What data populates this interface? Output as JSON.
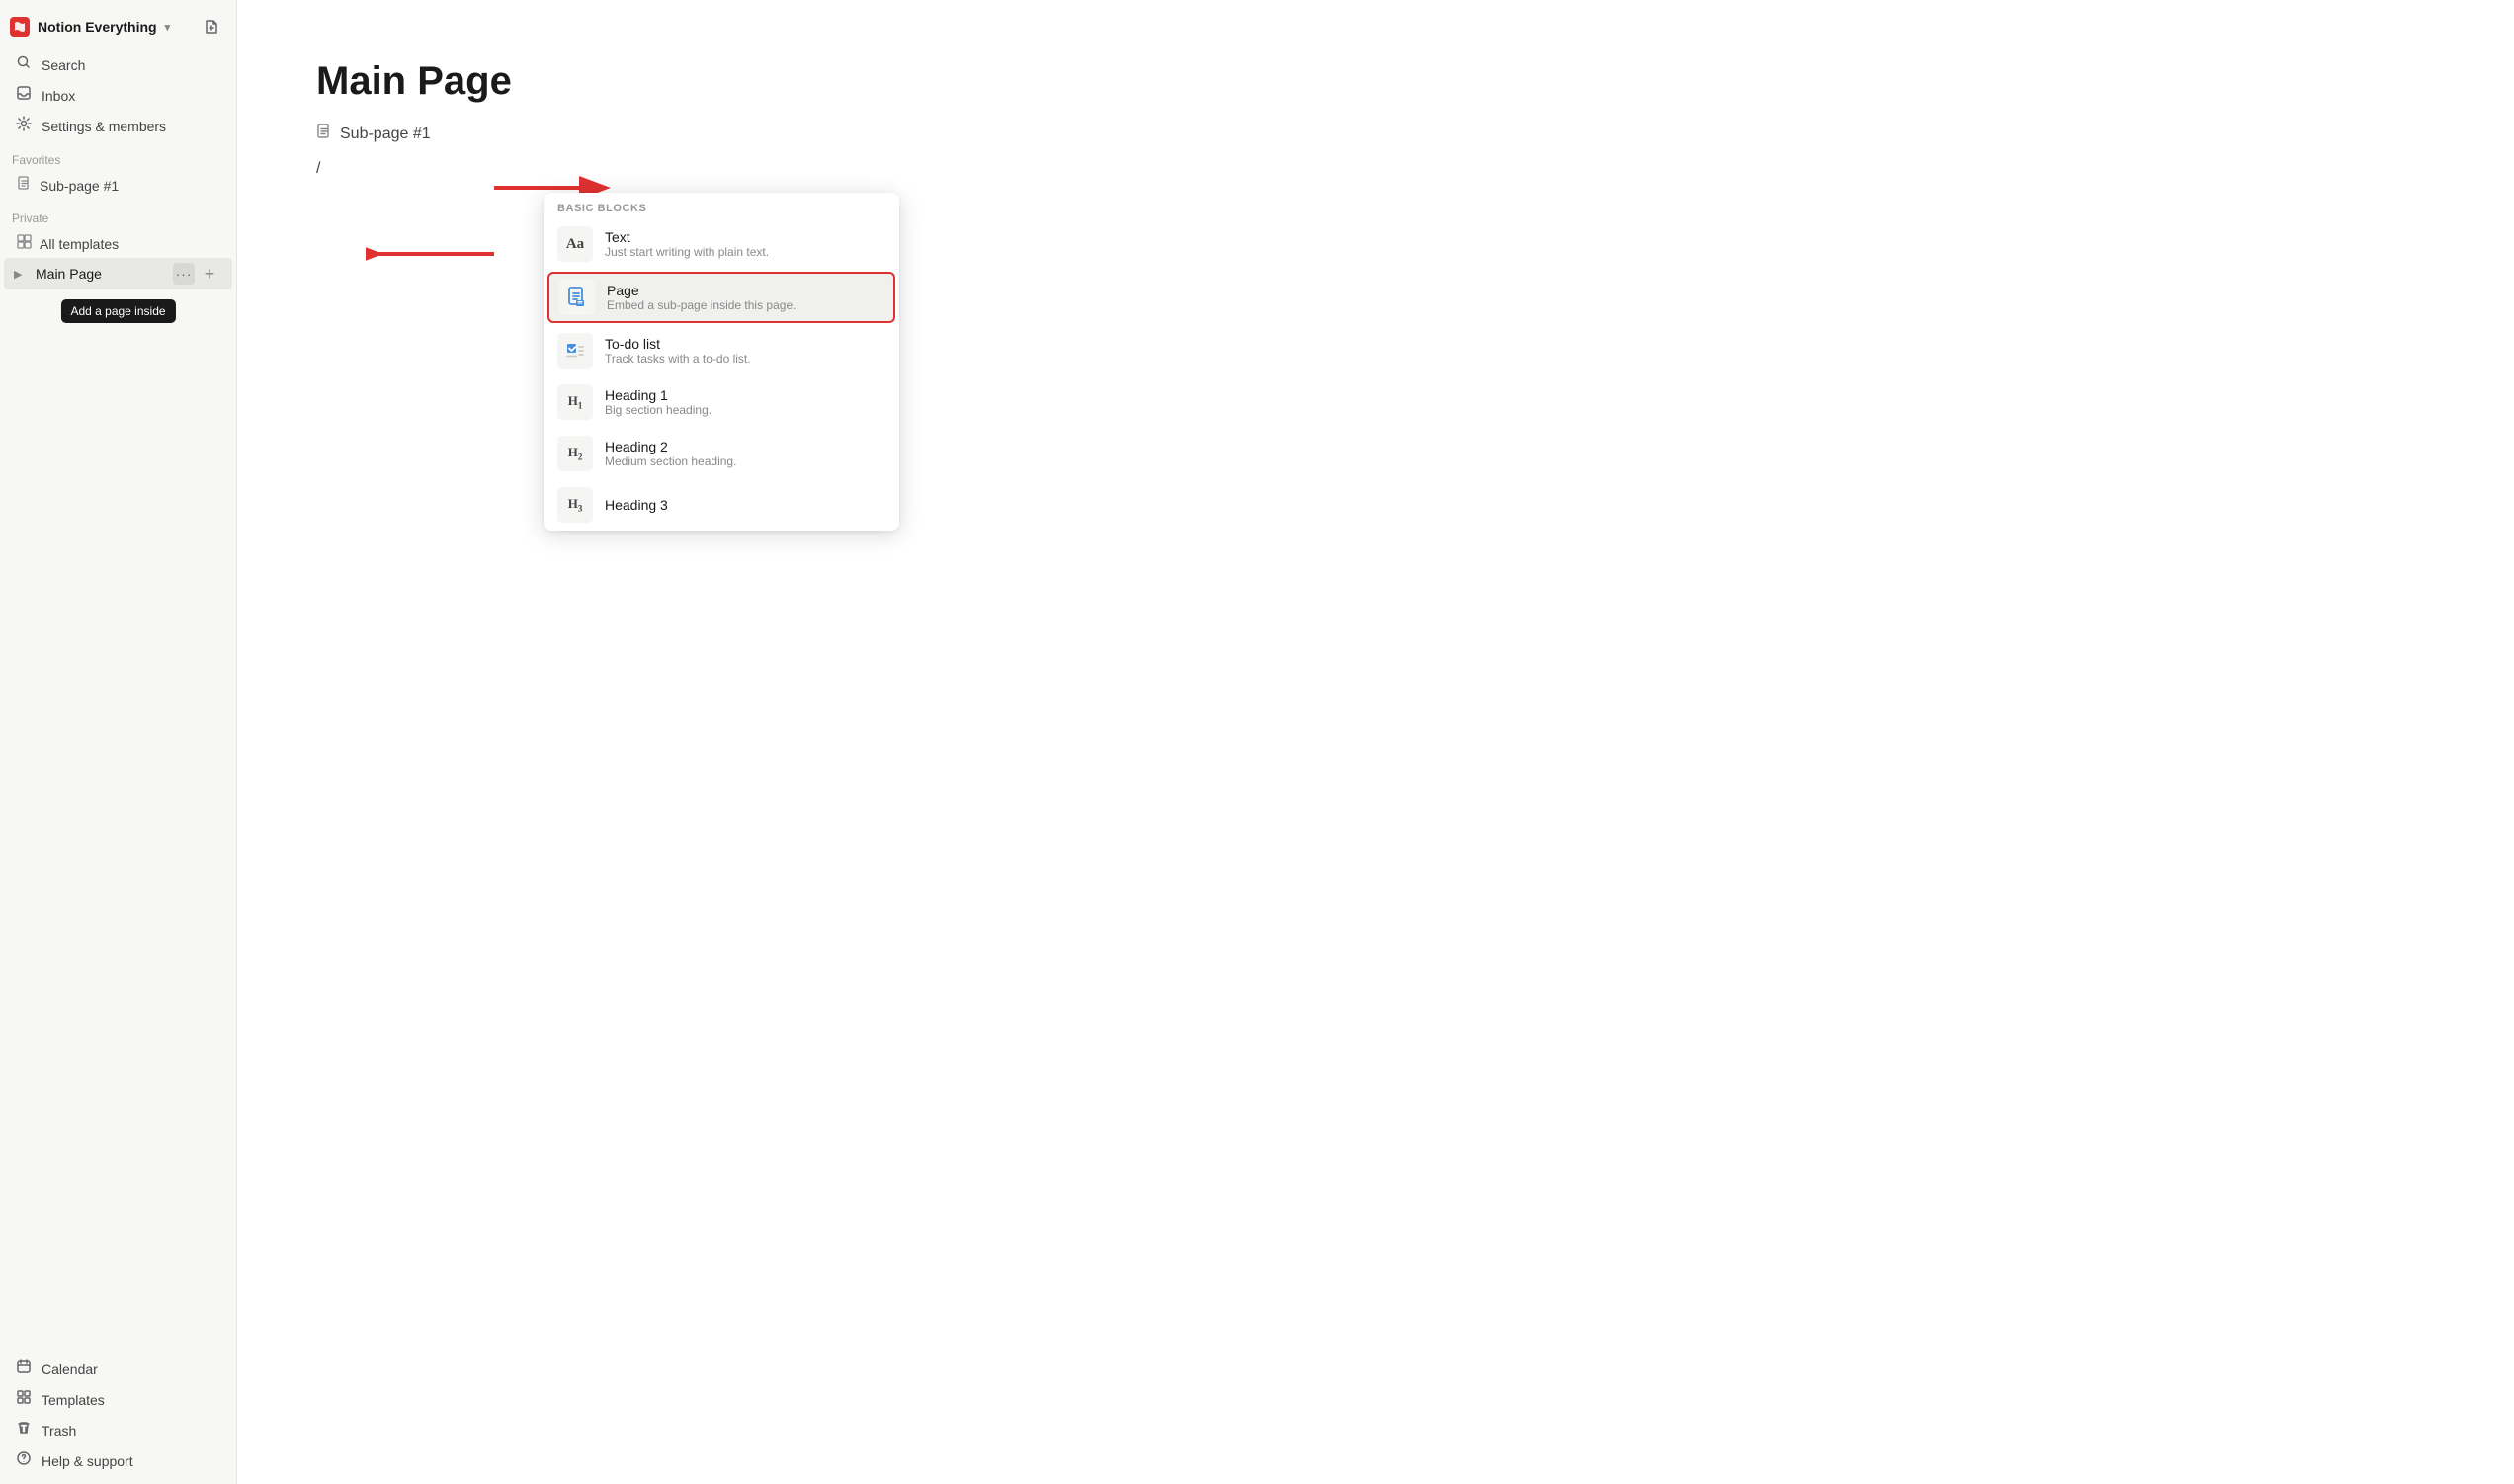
{
  "sidebar": {
    "workspace": {
      "name": "Notion Everything",
      "chevron": "▾"
    },
    "nav": [
      {
        "id": "search",
        "label": "Search",
        "icon": "🔍"
      },
      {
        "id": "inbox",
        "label": "Inbox",
        "icon": "📥"
      },
      {
        "id": "settings",
        "label": "Settings & members",
        "icon": "⚙️"
      }
    ],
    "sections": {
      "favorites": {
        "label": "Favorites",
        "items": [
          {
            "id": "subpage1",
            "label": "Sub-page #1"
          }
        ]
      },
      "private": {
        "label": "Private",
        "items": [
          {
            "id": "all-templates",
            "label": "All templates"
          },
          {
            "id": "main-page",
            "label": "Main Page"
          }
        ]
      }
    },
    "bottom": [
      {
        "id": "calendar",
        "label": "Calendar",
        "icon": "📅"
      },
      {
        "id": "templates",
        "label": "Templates",
        "icon": "📋"
      },
      {
        "id": "trash",
        "label": "Trash",
        "icon": "🗑️"
      },
      {
        "id": "help",
        "label": "Help & support",
        "icon": "❓"
      }
    ],
    "tooltip": "Add a page inside"
  },
  "main": {
    "page_title": "Main Page",
    "sub_page_label": "Sub-page #1",
    "slash_char": "/"
  },
  "slash_menu": {
    "section_label": "Basic blocks",
    "items": [
      {
        "id": "text",
        "name": "Text",
        "description": "Just start writing with plain text.",
        "icon": "Aa"
      },
      {
        "id": "page",
        "name": "Page",
        "description": "Embed a sub-page inside this page.",
        "icon": "📄",
        "selected": true
      },
      {
        "id": "todo",
        "name": "To-do list",
        "description": "Track tasks with a to-do list.",
        "icon": "✅"
      },
      {
        "id": "heading1",
        "name": "Heading 1",
        "description": "Big section heading.",
        "icon": "H1"
      },
      {
        "id": "heading2",
        "name": "Heading 2",
        "description": "Medium section heading.",
        "icon": "H2"
      },
      {
        "id": "heading3",
        "name": "Heading 3",
        "description": "",
        "icon": "H3"
      }
    ]
  }
}
